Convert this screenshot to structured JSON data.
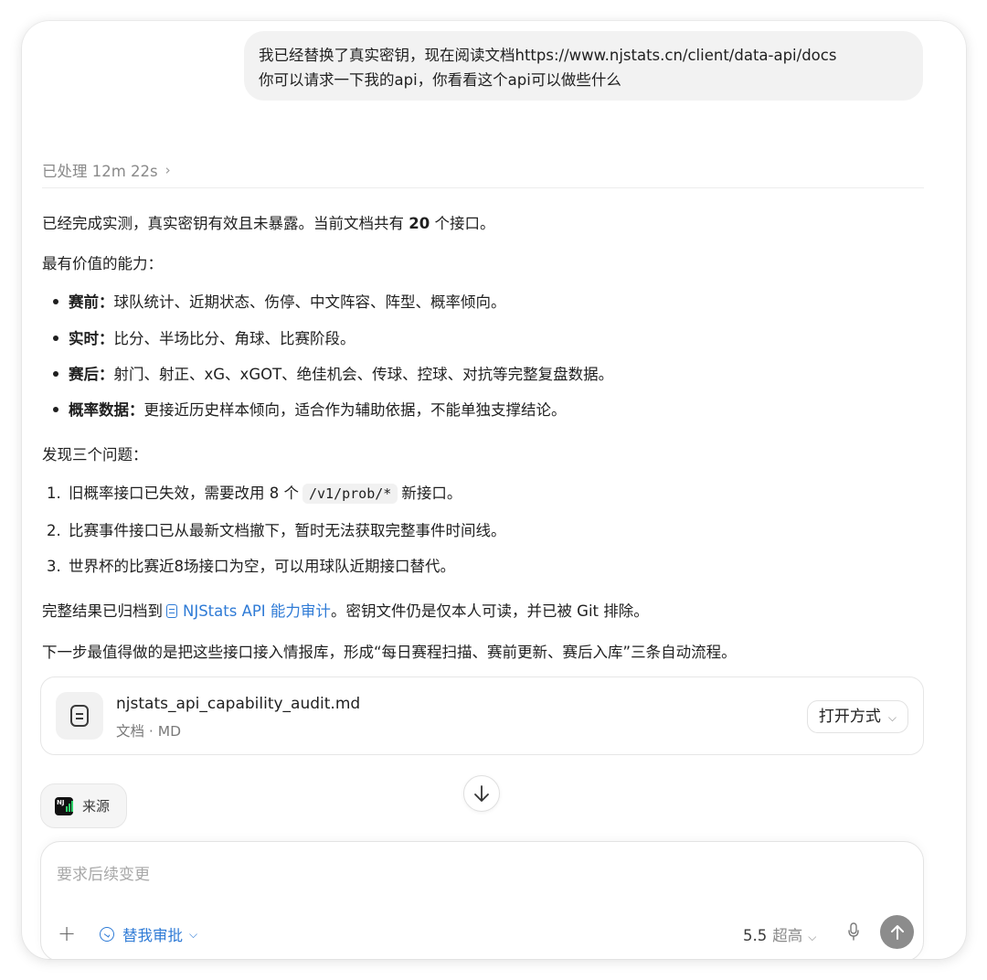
{
  "user_message": {
    "line1": "我已经替换了真实密钥，现在阅读文档https://www.njstats.cn/client/data-api/docs",
    "line2": "你可以请求一下我的api，你看看这个api可以做些什么"
  },
  "processed": {
    "label": "已处理 12m 22s",
    "chevron": "›"
  },
  "response": {
    "intro_pre": "已经完成实测，真实密钥有效且未暴露。当前文档共有 ",
    "intro_bold": "20",
    "intro_post": " 个接口。",
    "capabilities_heading": "最有价值的能力：",
    "capabilities": [
      {
        "title": "赛前：",
        "text": "球队统计、近期状态、伤停、中文阵容、阵型、概率倾向。"
      },
      {
        "title": "实时：",
        "text": "比分、半场比分、角球、比赛阶段。"
      },
      {
        "title": "赛后：",
        "text": "射门、射正、xG、xGOT、绝佳机会、传球、控球、对抗等完整复盘数据。"
      },
      {
        "title": "概率数据：",
        "text": "更接近历史样本倾向，适合作为辅助依据，不能单独支撑结论。"
      }
    ],
    "issues_heading": "发现三个问题：",
    "issues": [
      {
        "num": "1.",
        "pre": "旧概率接口已失效，需要改用 8 个",
        "code": "/v1/prob/*",
        "post": "新接口。"
      },
      {
        "num": "2.",
        "text": "比赛事件接口已从最新文档撤下，暂时无法获取完整事件时间线。"
      },
      {
        "num": "3.",
        "text": "世界杯的比赛近8场接口为空，可以用球队近期接口替代。"
      }
    ],
    "archive_pre": "完整结果已归档到",
    "archive_link": "NJStats API 能力审计",
    "archive_post": "。密钥文件仍是仅本人可读，并已被 Git 排除。",
    "next_step": "下一步最值得做的是把这些接口接入情报库，形成“每日赛程扫描、赛前更新、赛后入库”三条自动流程。"
  },
  "file": {
    "name": "njstats_api_capability_audit.md",
    "meta": "文档 · MD",
    "open_label": "打开方式"
  },
  "source": {
    "label": "来源",
    "logo_text": "NJ"
  },
  "composer": {
    "placeholder": "要求后续变更",
    "approve_label": "替我审批",
    "model": "5.5",
    "quality": "超高"
  },
  "colors": {
    "accent": "#2f7bd6",
    "send_button": "#8c8c8c"
  }
}
